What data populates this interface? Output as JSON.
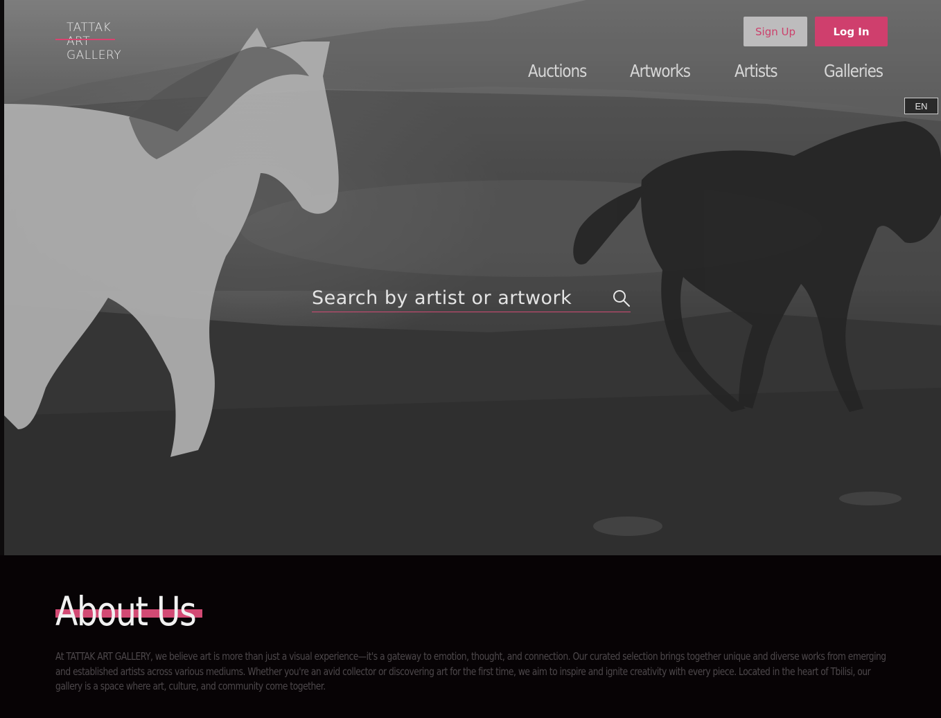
{
  "brand": {
    "logo_line1": "TATTAK",
    "logo_line2": "ART",
    "logo_line3": "GALLERY",
    "accent_color": "#d24a74"
  },
  "auth": {
    "signup_label": "Sign Up",
    "login_label": "Log In"
  },
  "nav": {
    "items": [
      {
        "label": "Auctions"
      },
      {
        "label": "Artworks"
      },
      {
        "label": "Artists"
      },
      {
        "label": "Galleries"
      }
    ]
  },
  "language": {
    "current": "EN"
  },
  "search": {
    "placeholder": "Search by artist or artwork",
    "icon": "search-icon"
  },
  "hero": {
    "background_icon": "horses-photo"
  },
  "about": {
    "title": "About Us",
    "body": "At TATTAK ART GALLERY, we believe art is more than just a visual experience—it's a gateway to emotion, thought, and connection. Our curated selection brings together unique and diverse works from emerging and established artists across various mediums. Whether you're an avid collector or discovering art for the first time, we aim to inspire and ignite creativity with every piece. Located in the heart of Tbilisi, our gallery is a space where art, culture, and community come together."
  }
}
